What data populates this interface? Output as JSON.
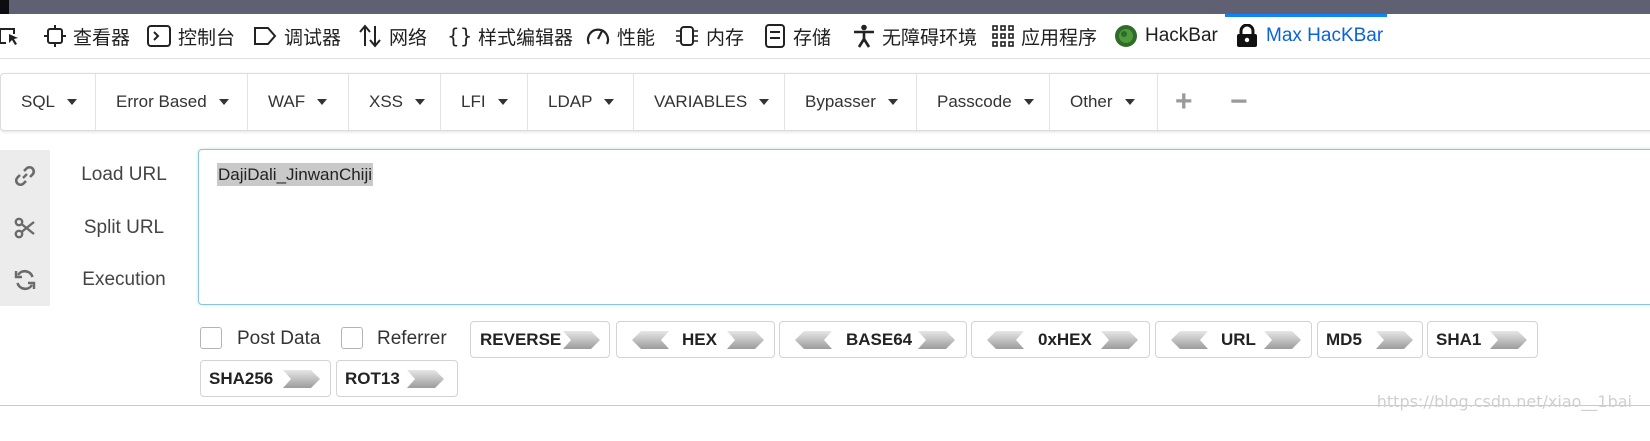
{
  "devtools": {
    "tabs": [
      {
        "label": "查看器",
        "icon": "inspector-icon"
      },
      {
        "label": "控制台",
        "icon": "console-icon"
      },
      {
        "label": "调试器",
        "icon": "debugger-icon"
      },
      {
        "label": "网络",
        "icon": "network-icon"
      },
      {
        "label": "样式编辑器",
        "icon": "style-editor-icon"
      },
      {
        "label": "性能",
        "icon": "performance-icon"
      },
      {
        "label": "内存",
        "icon": "memory-icon"
      },
      {
        "label": "存储",
        "icon": "storage-icon"
      },
      {
        "label": "无障碍环境",
        "icon": "accessibility-icon"
      },
      {
        "label": "应用程序",
        "icon": "application-icon"
      },
      {
        "label": "HackBar",
        "icon": "hackbar-icon"
      },
      {
        "label": "Max HacKBar",
        "icon": "lock-icon"
      }
    ],
    "active_tab": "Max HacKBar",
    "accent_color": "#0a84ff"
  },
  "menu": {
    "items": [
      "SQL",
      "Error Based",
      "WAF",
      "XSS",
      "LFI",
      "LDAP",
      "VARIABLES",
      "Bypasser",
      "Passcode",
      "Other"
    ],
    "plus": "+",
    "minus": "−"
  },
  "actions": {
    "load_url": "Load URL",
    "split_url": "Split URL",
    "execution": "Execution"
  },
  "url_input": {
    "value": "DajiDali_JinwanChiji"
  },
  "options": {
    "post_data": {
      "label": "Post Data",
      "checked": false
    },
    "referrer": {
      "label": "Referrer",
      "checked": false
    }
  },
  "encoders": {
    "reverse": "REVERSE",
    "hex": "HEX",
    "base64": "BASE64",
    "oxhex": "0xHEX",
    "url": "URL",
    "md5": "MD5",
    "sha1": "SHA1",
    "sha256": "SHA256",
    "rot13": "ROT13"
  },
  "watermark": "https://blog.csdn.net/xiao__1bai"
}
